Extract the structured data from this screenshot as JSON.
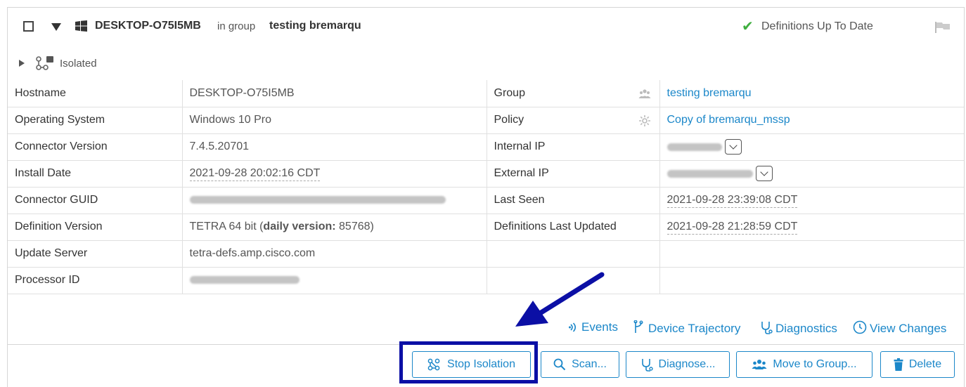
{
  "header": {
    "hostname": "DESKTOP-O75I5MB",
    "in_group_text": "in group",
    "group_name": "testing bremarqu",
    "definitions_status": "Definitions Up To Date"
  },
  "isolation": {
    "status": "Isolated"
  },
  "details": {
    "rows": [
      {
        "label": "Hostname",
        "value": "DESKTOP-O75I5MB",
        "label2": "Group",
        "value2": "testing bremarqu"
      },
      {
        "label": "Operating System",
        "value": "Windows 10 Pro",
        "label2": "Policy",
        "value2": "Copy of bremarqu_mssp"
      },
      {
        "label": "Connector Version",
        "value": "7.4.5.20701",
        "label2": "Internal IP",
        "value2": ""
      },
      {
        "label": "Install Date",
        "value": "2021-09-28 20:02:16 CDT",
        "label2": "External IP",
        "value2": ""
      },
      {
        "label": "Connector GUID",
        "value": "",
        "label2": "Last Seen",
        "value2": "2021-09-28 23:39:08 CDT"
      },
      {
        "label": "Definition Version",
        "value_prefix": "TETRA 64 bit (",
        "value_bold": "daily version:",
        "value_suffix": " 85768)",
        "label2": "Definitions Last Updated",
        "value2": "2021-09-28 21:28:59 CDT"
      },
      {
        "label": "Update Server",
        "value": "tetra-defs.amp.cisco.com",
        "label2": "",
        "value2": ""
      },
      {
        "label": "Processor ID",
        "value": "",
        "label2": "",
        "value2": ""
      }
    ]
  },
  "links": {
    "events": "Events",
    "device_trajectory": "Device Trajectory",
    "diagnostics": "Diagnostics",
    "view_changes": "View Changes"
  },
  "actions": {
    "stop_isolation": "Stop Isolation",
    "scan": "Scan...",
    "diagnose": "Diagnose...",
    "move_to_group": "Move to Group...",
    "delete": "Delete"
  },
  "colors": {
    "link": "#1b87c9",
    "highlight": "#0b0fa5",
    "check": "#3fae3f"
  }
}
